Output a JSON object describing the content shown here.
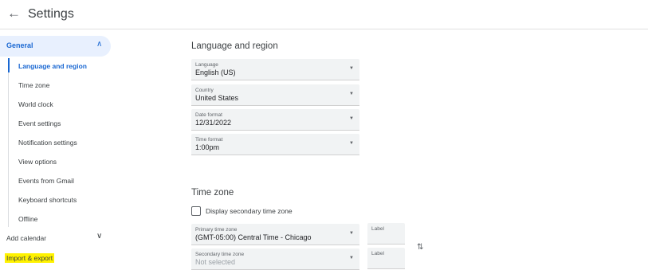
{
  "header": {
    "back_icon": "arrow-left-icon",
    "title": "Settings"
  },
  "sidebar": {
    "general_label": "General",
    "general_chevron": "chevron-up-icon",
    "items": [
      {
        "label": "Language and region",
        "active": true
      },
      {
        "label": "Time zone"
      },
      {
        "label": "World clock"
      },
      {
        "label": "Event settings"
      },
      {
        "label": "Notification settings"
      },
      {
        "label": "View options"
      },
      {
        "label": "Events from Gmail"
      },
      {
        "label": "Keyboard shortcuts"
      },
      {
        "label": "Offline"
      }
    ],
    "add_calendar_label": "Add calendar",
    "add_calendar_chevron": "chevron-down-icon",
    "import_export_label": "Import & export",
    "accent_color": "#1967d2",
    "highlight_color": "#fff200"
  },
  "language_region": {
    "heading": "Language and region",
    "language": {
      "caption": "Language",
      "value": "English (US)"
    },
    "country": {
      "caption": "Country",
      "value": "United States"
    },
    "date_format": {
      "caption": "Date format",
      "value": "12/31/2022"
    },
    "time_format": {
      "caption": "Time format",
      "value": "1:00pm"
    }
  },
  "time_zone": {
    "heading": "Time zone",
    "secondary_checkbox_label": "Display secondary time zone",
    "secondary_checked": false,
    "primary": {
      "caption": "Primary time zone",
      "value": "(GMT-05:00) Central Time - Chicago",
      "label_caption": "Label"
    },
    "secondary": {
      "caption": "Secondary time zone",
      "value": "Not selected",
      "label_caption": "Label"
    },
    "swap_icon": "swap-vertical-icon"
  }
}
